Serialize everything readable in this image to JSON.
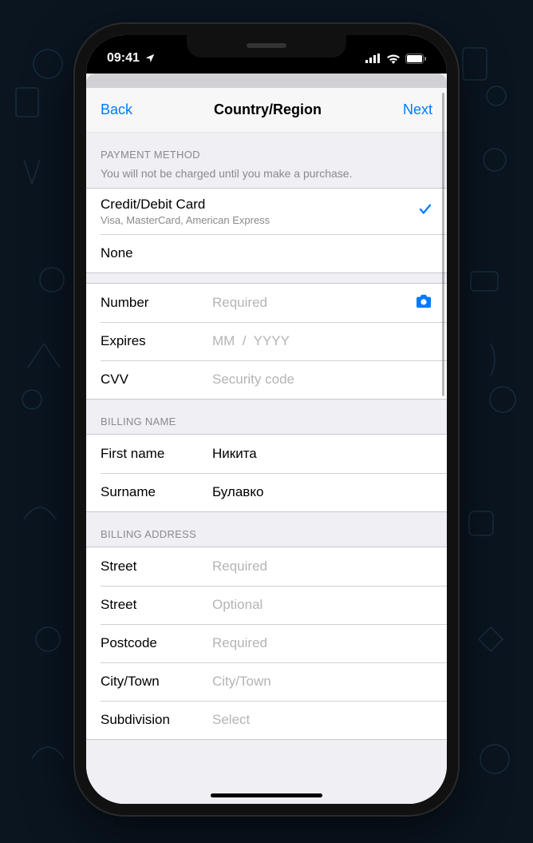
{
  "status": {
    "time": "09:41"
  },
  "nav": {
    "back": "Back",
    "title": "Country/Region",
    "next": "Next"
  },
  "payment": {
    "header": "PAYMENT METHOD",
    "note": "You will not be charged until you make a purchase.",
    "options": {
      "credit": {
        "title": "Credit/Debit Card",
        "sub": "Visa, MasterCard, American Express"
      },
      "none": {
        "title": "None"
      }
    },
    "fields": {
      "number": {
        "label": "Number",
        "placeholder": "Required"
      },
      "expires": {
        "label": "Expires",
        "placeholder": "MM  /  YYYY"
      },
      "cvv": {
        "label": "CVV",
        "placeholder": "Security code"
      }
    }
  },
  "billingName": {
    "header": "BILLING NAME",
    "first": {
      "label": "First name",
      "value": "Никита"
    },
    "surname": {
      "label": "Surname",
      "value": "Булавко"
    }
  },
  "billingAddress": {
    "header": "BILLING ADDRESS",
    "street1": {
      "label": "Street",
      "placeholder": "Required"
    },
    "street2": {
      "label": "Street",
      "placeholder": "Optional"
    },
    "postcode": {
      "label": "Postcode",
      "placeholder": "Required"
    },
    "city": {
      "label": "City/Town",
      "placeholder": "City/Town"
    },
    "subdivision": {
      "label": "Subdivision",
      "placeholder": "Select"
    }
  }
}
